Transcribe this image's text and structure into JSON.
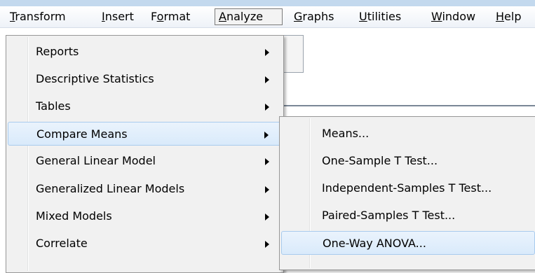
{
  "menubar": {
    "items": [
      {
        "pre": "",
        "ul": "T",
        "post": "ransform"
      },
      {
        "pre": "",
        "ul": "I",
        "post": "nsert"
      },
      {
        "pre": "F",
        "ul": "o",
        "post": "rmat"
      },
      {
        "pre": "",
        "ul": "A",
        "post": "nalyze"
      },
      {
        "pre": "",
        "ul": "G",
        "post": "raphs"
      },
      {
        "pre": "",
        "ul": "U",
        "post": "tilities"
      },
      {
        "pre": "",
        "ul": "W",
        "post": "indow"
      },
      {
        "pre": "",
        "ul": "H",
        "post": "elp"
      }
    ],
    "active_index": 3
  },
  "analyze_menu": {
    "items": [
      {
        "label": "Reports",
        "submenu": true
      },
      {
        "label": "Descriptive Statistics",
        "submenu": true
      },
      {
        "label": "Tables",
        "submenu": true
      },
      {
        "label": "Compare Means",
        "submenu": true
      },
      {
        "label": "General Linear Model",
        "submenu": true
      },
      {
        "label": "Generalized Linear Models",
        "submenu": true
      },
      {
        "label": "Mixed Models",
        "submenu": true
      },
      {
        "label": "Correlate",
        "submenu": true
      }
    ],
    "highlighted_index": 3
  },
  "compare_means_menu": {
    "items": [
      {
        "label": "Means..."
      },
      {
        "label": "One-Sample T Test..."
      },
      {
        "label": "Independent-Samples T Test..."
      },
      {
        "label": "Paired-Samples T Test..."
      },
      {
        "label": "One-Way ANOVA..."
      }
    ],
    "highlighted_index": 4
  },
  "colors": {
    "highlight_border": "#a8cbee",
    "highlight_fill": "#d9eafb",
    "menu_background": "#f1f1f1"
  }
}
